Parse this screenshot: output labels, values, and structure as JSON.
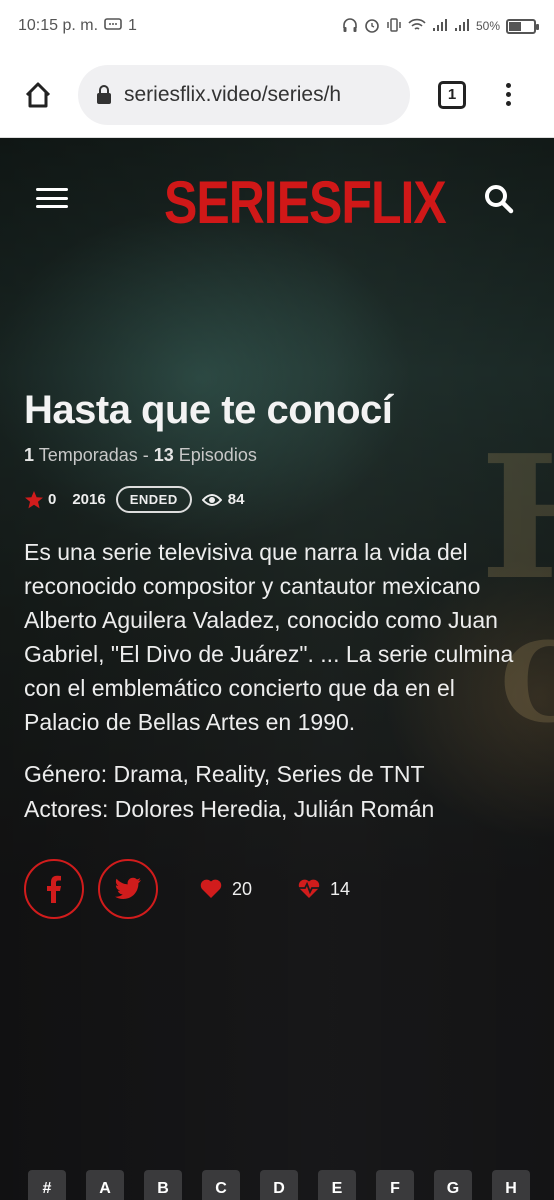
{
  "status": {
    "time": "10:15 p. m.",
    "notif_count": "1",
    "battery": "50%",
    "battery_level": 0.5
  },
  "browser": {
    "url": "seriesflix.video/series/h",
    "tab_count": "1"
  },
  "site": {
    "logo": "SERIESFLIX"
  },
  "show": {
    "title": "Hasta que te conocí",
    "seasons": "1",
    "seasons_label": " Temporadas - ",
    "episodes": "13",
    "episodes_label": " Episodios",
    "rating": "0",
    "year": "2016",
    "status": "ENDED",
    "views": "84",
    "description": "Es una serie televisiva que narra la vida del reconocido compositor y cantautor mexicano Alberto Aguilera Valadez, conocido como Juan Gabriel, \"El Divo de Juárez\". ... La serie culmina con el emblemático concierto que da en el Palacio de Bellas Artes en 1990.",
    "genre": "Género: Drama, Reality, Series de TNT",
    "actors": "Actores: Dolores Heredia, Julián Román",
    "likes": "20",
    "loves": "14"
  },
  "alphabet": [
    "#",
    "A",
    "B",
    "C",
    "D",
    "E",
    "F",
    "G",
    "H"
  ],
  "colors": {
    "accent": "#d01818",
    "background": "#1b1b1d"
  }
}
